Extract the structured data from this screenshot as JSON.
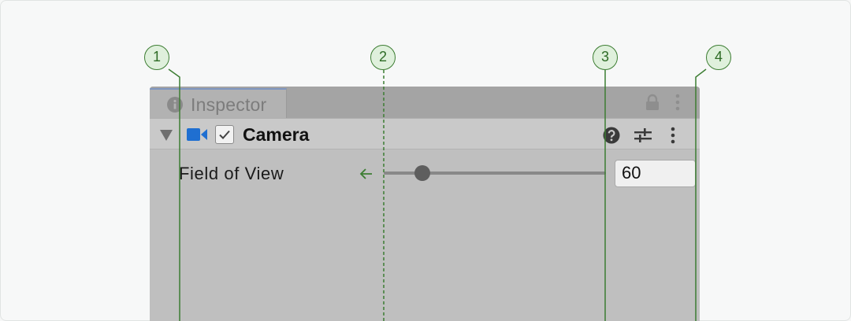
{
  "inspector": {
    "tab_label": "Inspector",
    "component": {
      "title": "Camera",
      "enabled": true,
      "property": {
        "label": "Field of View",
        "value": "60"
      }
    }
  },
  "callouts": [
    "1",
    "2",
    "3",
    "4"
  ],
  "colors": {
    "annotation": "#3c7d32",
    "camera_icon": "#1f6fd1",
    "panel_bg": "#bfbfbf",
    "tabbar_bg": "#a4a4a4"
  },
  "icons": [
    "info-icon",
    "lock-icon",
    "kebab-menu-icon",
    "foldout-triangle-icon",
    "camera-icon",
    "checkmark-icon",
    "help-icon",
    "presets-icon",
    "arrow-left-icon"
  ]
}
